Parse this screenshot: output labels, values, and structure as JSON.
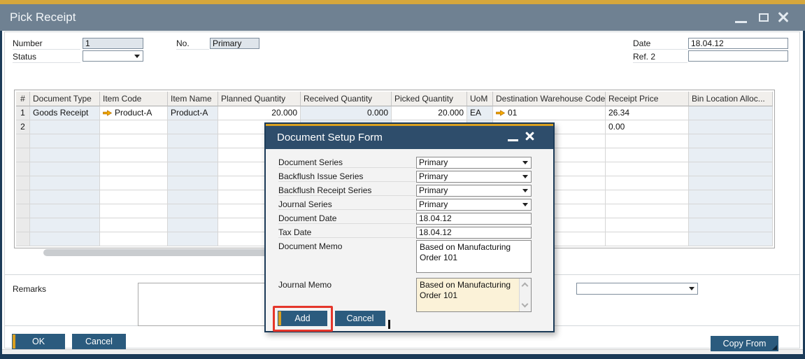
{
  "window": {
    "title": "Pick Receipt"
  },
  "form": {
    "number_label": "Number",
    "number_value": "1",
    "no_label": "No.",
    "no_value": "Primary",
    "status_label": "Status",
    "status_value": "",
    "date_label": "Date",
    "date_value": "18.04.12",
    "ref2_label": "Ref. 2",
    "ref2_value": ""
  },
  "table": {
    "columns": [
      "#",
      "Document Type",
      "Item Code",
      "Item Name",
      "Planned Quantity",
      "Received Quantity",
      "Picked Quantity",
      "UoM",
      "Destination Warehouse Code",
      "Receipt Price",
      "Bin Location Alloc..."
    ],
    "rows": [
      [
        "1",
        "Goods Receipt",
        "Product-A",
        "Product-A",
        "20.000",
        "0.000",
        "20.000",
        "EA",
        "01",
        "26.34",
        ""
      ],
      [
        "2",
        "",
        "",
        "",
        "",
        "",
        "",
        "",
        "",
        "0.00",
        ""
      ]
    ],
    "total_rows": 10,
    "link_cells": [
      [
        0,
        2
      ],
      [
        0,
        8
      ]
    ]
  },
  "remarks": {
    "label": "Remarks",
    "value": ""
  },
  "side_dropdown": {
    "value": ""
  },
  "footer": {
    "ok_label": "OK",
    "cancel_label": "Cancel",
    "copy_from_label": "Copy From"
  },
  "dialog": {
    "title": "Document Setup Form",
    "fields": [
      {
        "label": "Document Series",
        "value": "Primary",
        "type": "select"
      },
      {
        "label": "Backflush Issue Series",
        "value": "Primary",
        "type": "select"
      },
      {
        "label": "Backflush Receipt Series",
        "value": "Primary",
        "type": "select"
      },
      {
        "label": "Journal Series",
        "value": "Primary",
        "type": "select"
      },
      {
        "label": "Document Date",
        "value": "18.04.12",
        "type": "text"
      },
      {
        "label": "Tax Date",
        "value": "18.04.12",
        "type": "text"
      }
    ],
    "document_memo_label": "Document Memo",
    "document_memo_value": "Based on Manufacturing Order 101",
    "journal_memo_label": "Journal Memo",
    "journal_memo_value": "Based on Manufacturing Order 101",
    "add_label": "Add",
    "cancel_label": "Cancel"
  },
  "colors": {
    "accent_gold": "#D6A73C",
    "navy_border": "#1C3B58",
    "button_navy": "#2B5B7E",
    "titlebar": "#6F8192",
    "modal_titlebar": "#2E4D6B",
    "annotation_red": "#E5362B",
    "memo_highlight": "#FBF2D8",
    "tinted_cell": "#E8EEF4",
    "link_arrow": "#F5AB00"
  }
}
